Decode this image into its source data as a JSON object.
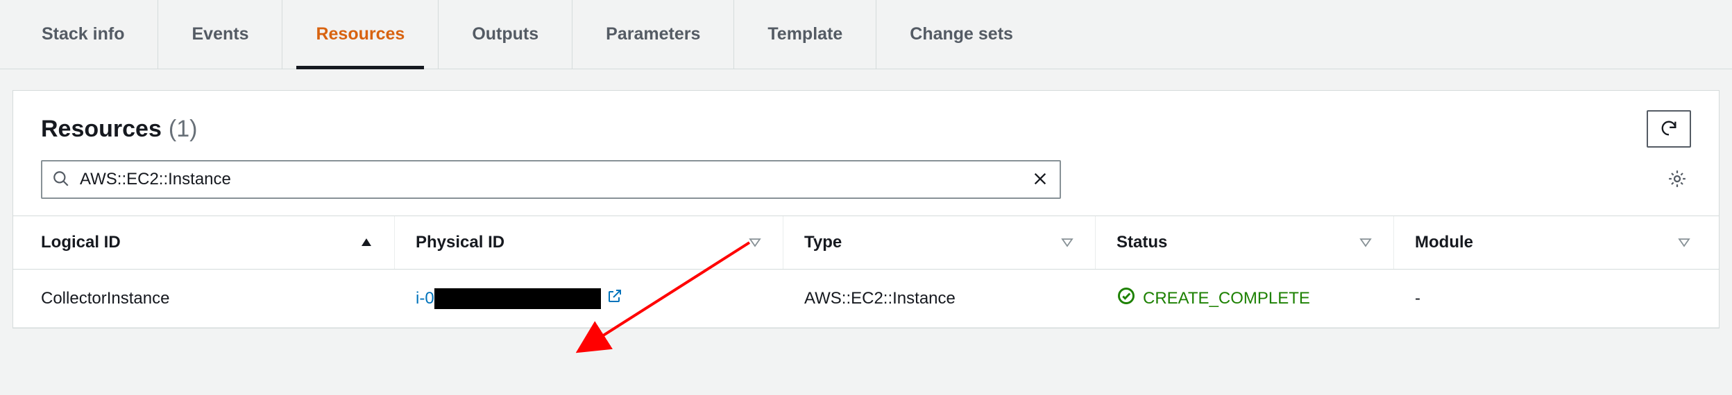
{
  "tabs": [
    {
      "label": "Stack info",
      "active": false
    },
    {
      "label": "Events",
      "active": false
    },
    {
      "label": "Resources",
      "active": true
    },
    {
      "label": "Outputs",
      "active": false
    },
    {
      "label": "Parameters",
      "active": false
    },
    {
      "label": "Template",
      "active": false
    },
    {
      "label": "Change sets",
      "active": false
    }
  ],
  "panel": {
    "title": "Resources",
    "count": "(1)"
  },
  "search": {
    "value": "AWS::EC2::Instance"
  },
  "columns": {
    "logical": "Logical ID",
    "physical": "Physical ID",
    "type": "Type",
    "status": "Status",
    "module": "Module"
  },
  "rows": [
    {
      "logical_id": "CollectorInstance",
      "physical_id_prefix": "i-0",
      "type": "AWS::EC2::Instance",
      "status": "CREATE_COMPLETE",
      "module": "-"
    }
  ],
  "colors": {
    "accent_orange": "#d86310",
    "link_blue": "#0073bb",
    "success_green": "#1d8102"
  }
}
